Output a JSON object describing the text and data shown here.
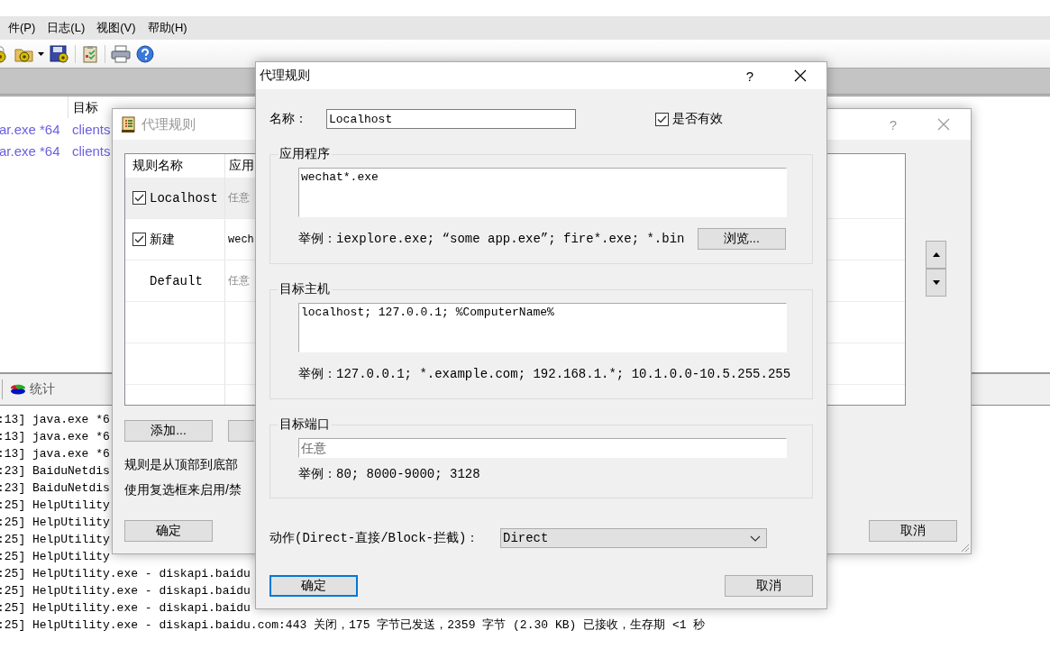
{
  "app": {
    "menu": [
      "件(P)",
      "日志(L)",
      "视图(V)",
      "帮助(H)"
    ],
    "connections": {
      "columns": [
        "目标"
      ],
      "rows": [
        {
          "application": "ar.exe *64",
          "target": "clients"
        },
        {
          "application": "ar.exe *64",
          "target": "clients"
        }
      ]
    },
    "panel_tabs": [
      {
        "label": "统计",
        "kind": "icon"
      }
    ],
    "log": [
      ":13] java.exe *6",
      ":13] java.exe *6",
      ":13] java.exe *6",
      ":23] BaiduNetdis",
      ":23] BaiduNetdis",
      ":25] HelpUtility",
      ":25] HelpUtility",
      ":25] HelpUtility",
      ":25] HelpUtility",
      ":25] HelpUtility.exe - diskapi.baidu",
      ":25] HelpUtility.exe - diskapi.baidu",
      ":25] HelpUtility.exe - diskapi.baidu",
      ":25] HelpUtility.exe - diskapi.baidu.com:443 关闭，175 字节已发送，2359 字节 (2.30 KB) 已接收，生存期 <1 秒"
    ]
  },
  "rules_window": {
    "title": "代理规则",
    "active": false,
    "help": "?",
    "columns": [
      "规则名称",
      "应用"
    ],
    "rows": [
      {
        "kind": "check",
        "checked": true,
        "selected": true,
        "name": "Localhost",
        "application": "任意",
        "dimmed": true
      },
      {
        "kind": "check",
        "checked": true,
        "selected": false,
        "name": "新建",
        "application": "wech",
        "dimmed": false
      },
      {
        "kind": "plain",
        "selected": false,
        "name": "Default",
        "application": "任意",
        "dimmed": true
      }
    ],
    "add_button": "添加...",
    "notes": [
      "规则是从顶部到底部",
      "使用复选框来启用/禁"
    ],
    "ok": "确定",
    "cancel": "取消"
  },
  "rule_dialog": {
    "title": "代理规则",
    "active": true,
    "help": "?",
    "name_label": "名称：",
    "name_value": "Localhost",
    "enabled_label": "是否有效",
    "enabled": true,
    "groups": [
      {
        "title": "应用程序",
        "kind": "multiline",
        "value": "wechat*.exe",
        "example": "举例：iexplore.exe; “some app.exe”; fire*.exe; *.bin",
        "button": "浏览..."
      },
      {
        "title": "目标主机",
        "kind": "multiline",
        "value": "localhost; 127.0.0.1; %ComputerName%",
        "example": "举例：127.0.0.1; *.example.com; 192.168.1.*; 10.1.0.0-10.5.255.255"
      },
      {
        "title": "目标端口",
        "kind": "single",
        "placeholder": "任意",
        "example": "举例：80; 8000-9000; 3128"
      }
    ],
    "action_label": "动作(Direct-直接/Block-拦截)：",
    "action_value": "Direct",
    "ok": "确定",
    "cancel": "取消"
  }
}
